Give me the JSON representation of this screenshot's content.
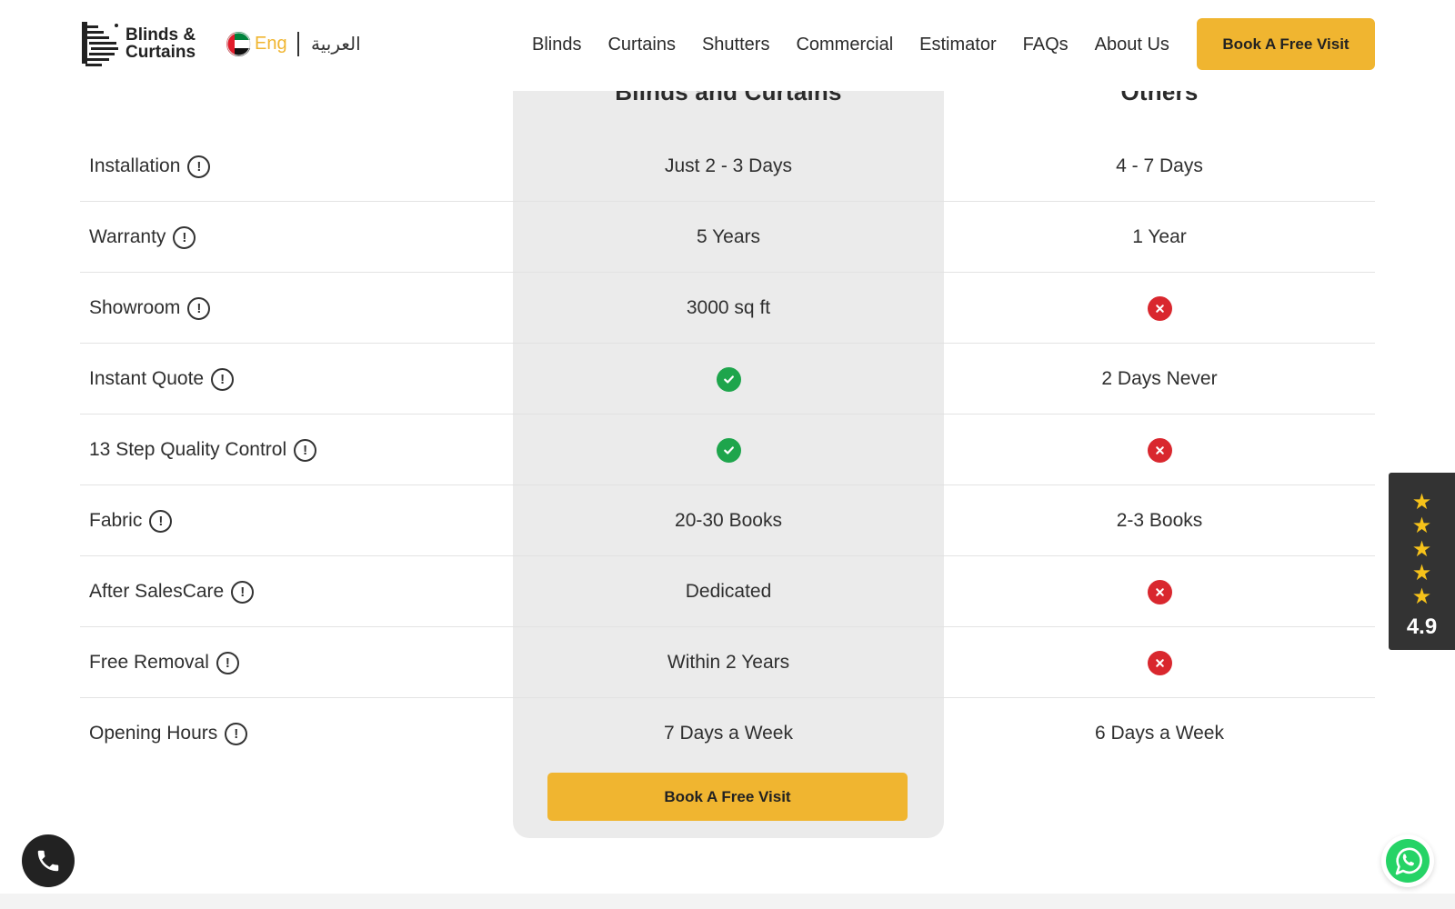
{
  "header": {
    "logo_text_1": "Blinds &",
    "logo_text_2": "Curtains",
    "lang_en": "Eng",
    "lang_ar": "العربية",
    "nav": [
      "Blinds",
      "Curtains",
      "Shutters",
      "Commercial",
      "Estimator",
      "FAQs",
      "About Us"
    ],
    "cta_label": "Book A Free Visit",
    "accent_color": "#f0b530"
  },
  "comparison": {
    "col_recommended": "Blinds and Curtains",
    "col_others": "Others",
    "rows": [
      {
        "feature": "Installation",
        "ours": "Just 2 - 3 Days",
        "ours_icon": "",
        "others": "4 - 7 Days",
        "others_icon": ""
      },
      {
        "feature": "Warranty",
        "ours": "5 Years",
        "ours_icon": "",
        "others": "1 Year",
        "others_icon": ""
      },
      {
        "feature": "Showroom",
        "ours": "3000 sq ft",
        "ours_icon": "",
        "others": "",
        "others_icon": "cross"
      },
      {
        "feature": "Instant Quote",
        "ours": "",
        "ours_icon": "check",
        "others": "2 Days Never",
        "others_icon": ""
      },
      {
        "feature": "13 Step Quality Control",
        "ours": "",
        "ours_icon": "check",
        "others": "",
        "others_icon": "cross"
      },
      {
        "feature": "Fabric",
        "ours": "20-30 Books",
        "ours_icon": "",
        "others": "2-3 Books",
        "others_icon": ""
      },
      {
        "feature": "After SalesCare",
        "ours": "Dedicated",
        "ours_icon": "",
        "others": "",
        "others_icon": "cross"
      },
      {
        "feature": "Free Removal",
        "ours": "Within 2 Years",
        "ours_icon": "",
        "others": "",
        "others_icon": "cross"
      },
      {
        "feature": "Opening Hours",
        "ours": "7 Days a Week",
        "ours_icon": "",
        "others": "6 Days a Week",
        "others_icon": ""
      }
    ],
    "cta_label": "Book A Free Visit",
    "check_color": "#1ea54c",
    "cross_color": "#d9272e"
  },
  "rating": {
    "stars": 5,
    "value": "4.9",
    "star_color": "#f6c21a"
  },
  "widgets": {
    "phone_icon": "phone-icon",
    "whatsapp_icon": "whatsapp-icon"
  }
}
